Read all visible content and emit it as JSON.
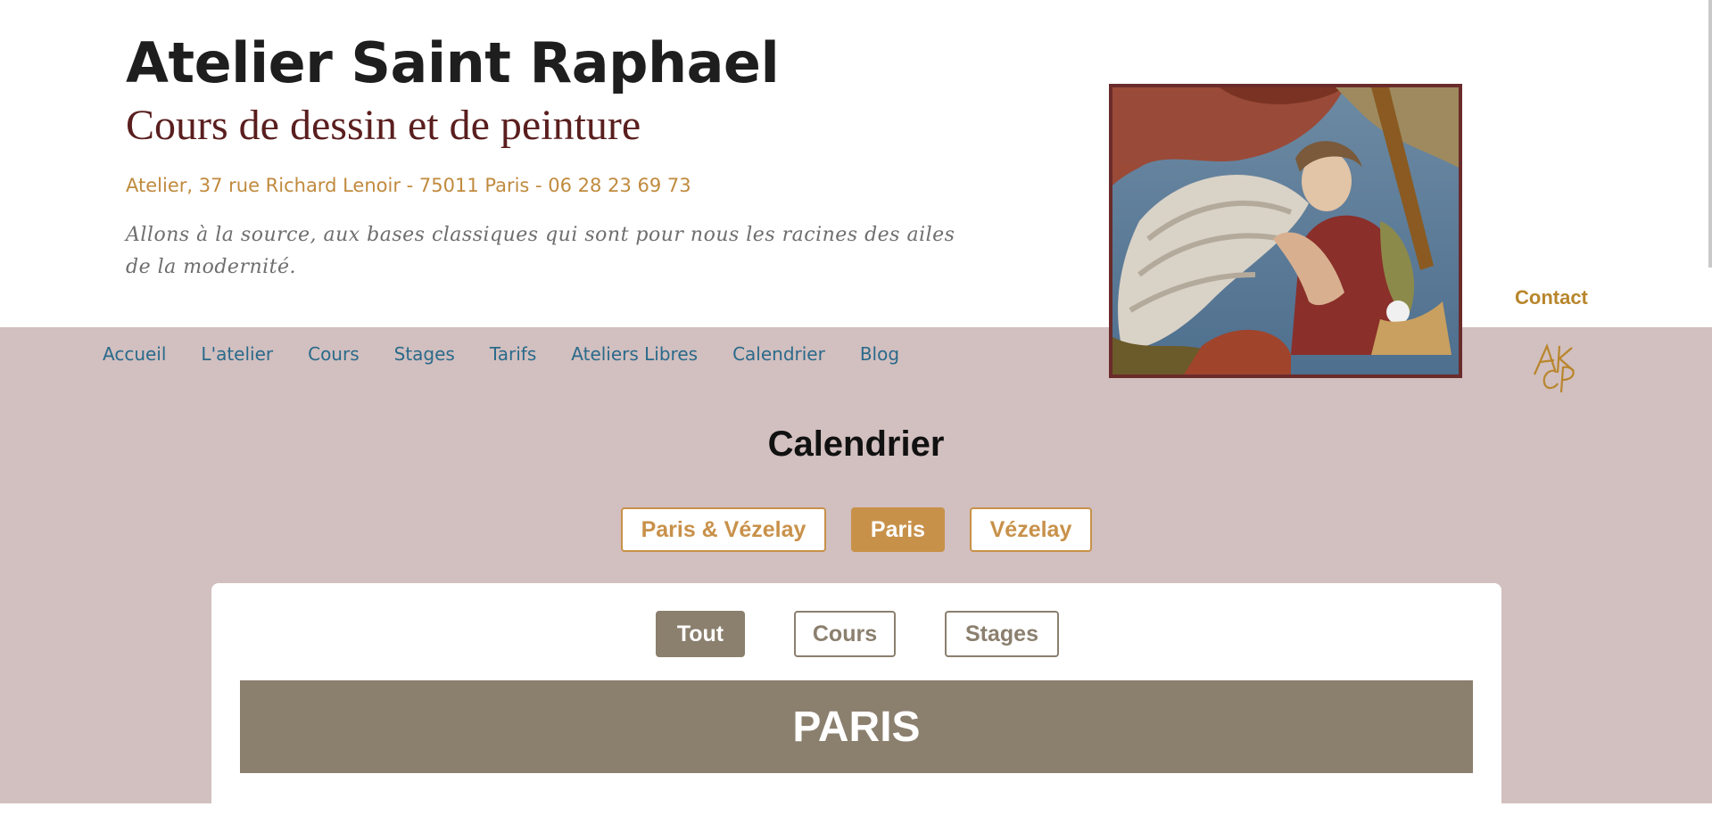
{
  "header": {
    "title": "Atelier Saint Raphael",
    "subtitle": "Cours de dessin et de peinture",
    "address": "Atelier, 37 rue Richard Lenoir - 75011 Paris - 06 28 23 69 73",
    "quote": "Allons à la source, aux bases classiques qui sont pour nous les racines des ailes de la modernité."
  },
  "nav": {
    "items": [
      {
        "label": "Accueil"
      },
      {
        "label": "L'atelier"
      },
      {
        "label": "Cours"
      },
      {
        "label": "Stages"
      },
      {
        "label": "Tarifs"
      },
      {
        "label": "Ateliers Libres"
      },
      {
        "label": "Calendrier"
      },
      {
        "label": "Blog"
      }
    ],
    "contact": "Contact"
  },
  "page": {
    "title": "Calendrier",
    "location_tabs": [
      {
        "label": "Paris & Vézelay",
        "active": false
      },
      {
        "label": "Paris",
        "active": true
      },
      {
        "label": "Vézelay",
        "active": false
      }
    ],
    "type_tabs": [
      {
        "label": "Tout",
        "active": true
      },
      {
        "label": "Cours",
        "active": false
      },
      {
        "label": "Stages",
        "active": false
      }
    ],
    "section_title": "PARIS"
  },
  "colors": {
    "accent_gold": "#c8914a",
    "band_rose": "#d2bfbf",
    "taupe": "#8b7f6e",
    "nav_blue": "#2a6a8a"
  }
}
